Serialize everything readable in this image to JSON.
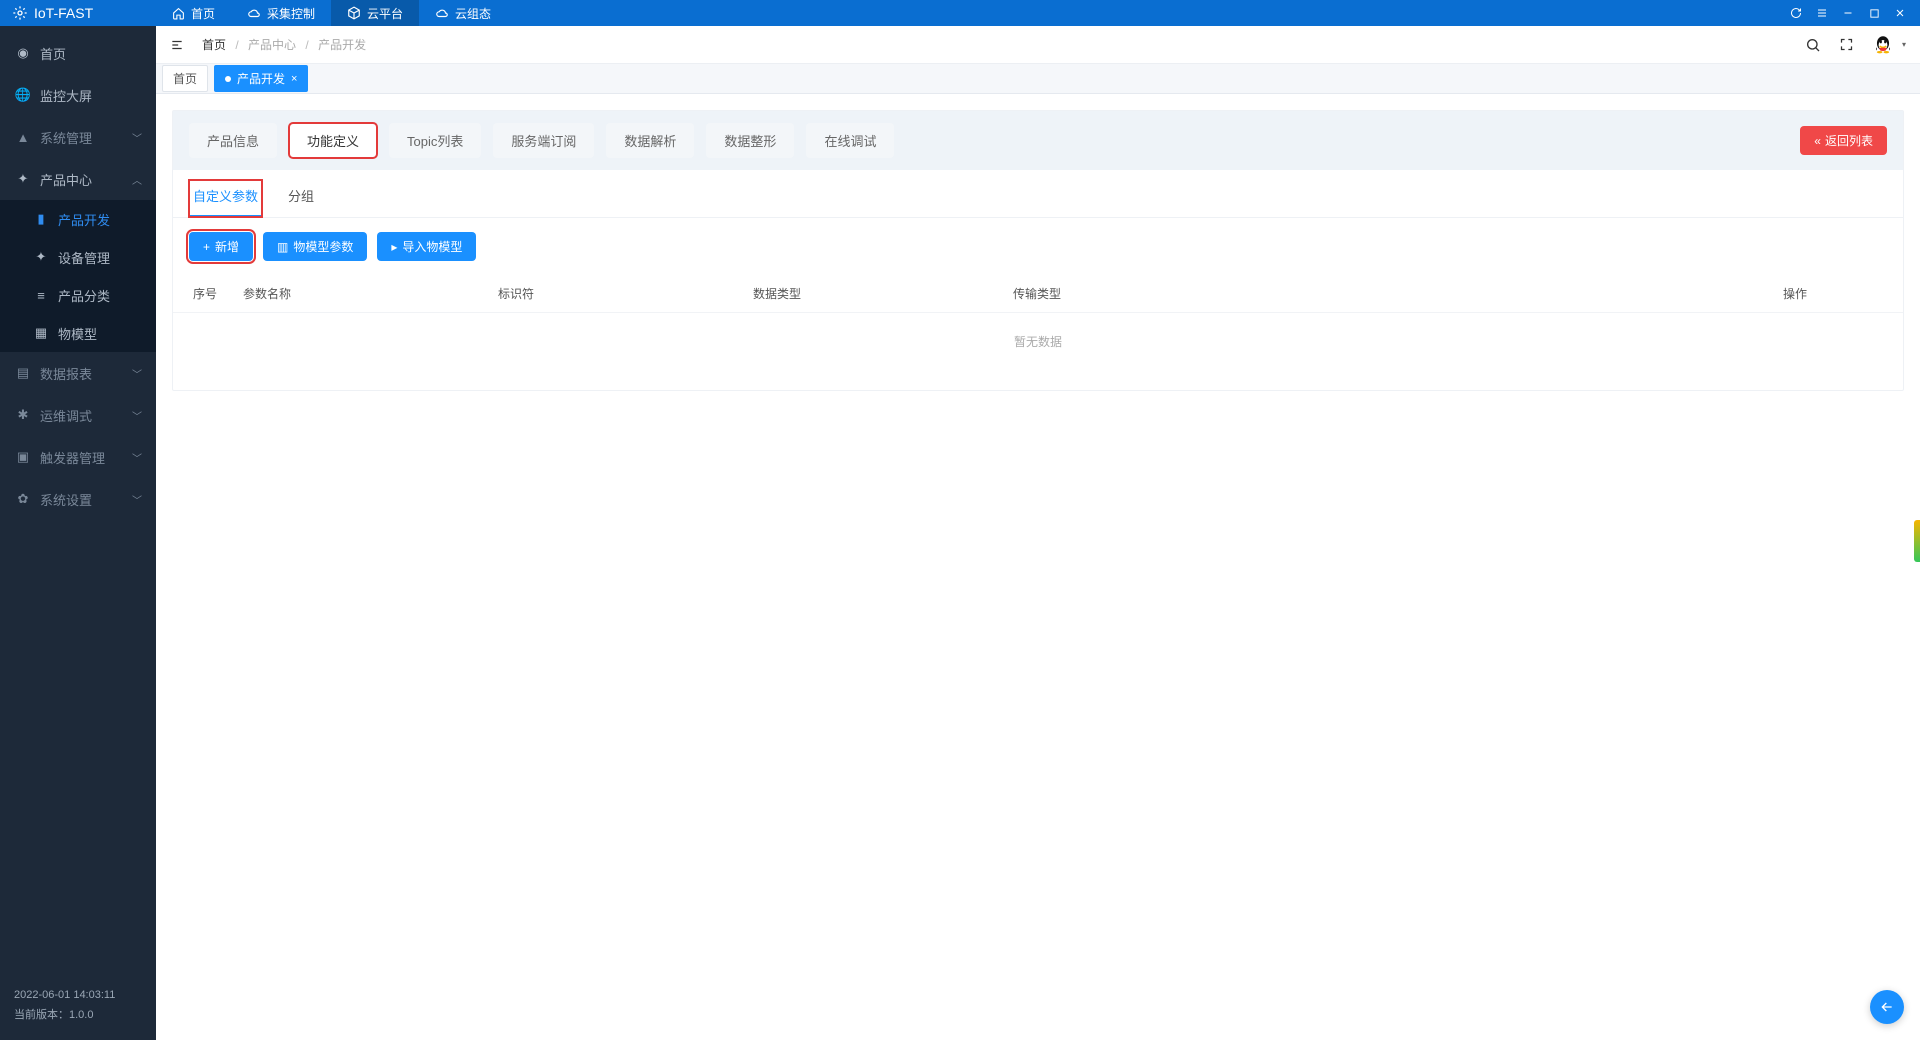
{
  "brand": "IoT-FAST",
  "topnav": [
    "首页",
    "采集控制",
    "云平台",
    "云组态"
  ],
  "topnav_active": 2,
  "sidebar": {
    "items": [
      {
        "icon": "dashboard",
        "label": "首页"
      },
      {
        "icon": "globe",
        "label": "监控大屏"
      },
      {
        "icon": "user",
        "label": "系统管理",
        "chev": true,
        "dim": true
      },
      {
        "icon": "gear",
        "label": "产品中心",
        "chev": true,
        "open": true,
        "children": [
          {
            "icon": "folder",
            "label": "产品开发",
            "active": true
          },
          {
            "icon": "gear",
            "label": "设备管理"
          },
          {
            "icon": "list",
            "label": "产品分类"
          },
          {
            "icon": "grid",
            "label": "物模型"
          }
        ]
      },
      {
        "icon": "chart",
        "label": "数据报表",
        "chev": true,
        "dim": true
      },
      {
        "icon": "bug",
        "label": "运维调式",
        "chev": true,
        "dim": true
      },
      {
        "icon": "trigger",
        "label": "触发器管理",
        "chev": true,
        "dim": true
      },
      {
        "icon": "cog",
        "label": "系统设置",
        "chev": true,
        "dim": true
      }
    ],
    "timestamp": "2022-06-01 14:03:11",
    "version_label": "当前版本：1.0.0"
  },
  "breadcrumb": [
    "首页",
    "产品中心",
    "产品开发"
  ],
  "page_tabs": [
    {
      "label": "首页",
      "active": false
    },
    {
      "label": "产品开发",
      "active": true,
      "closable": true
    }
  ],
  "panel": {
    "tabs": [
      "产品信息",
      "功能定义",
      "Topic列表",
      "服务端订阅",
      "数据解析",
      "数据整形",
      "在线调试"
    ],
    "active": 1,
    "back_label": "返回列表"
  },
  "subtabs": [
    "自定义参数",
    "分组"
  ],
  "subtabs_active": 0,
  "action_buttons": [
    {
      "key": "add",
      "label": "新增",
      "icon": "+",
      "highlight": true
    },
    {
      "key": "model-params",
      "label": "物模型参数",
      "icon": "db"
    },
    {
      "key": "import",
      "label": "导入物模型",
      "icon": "folder"
    }
  ],
  "table": {
    "cols": [
      "序号",
      "参数名称",
      "标识符",
      "数据类型",
      "传输类型",
      "操作"
    ],
    "empty": "暂无数据"
  }
}
